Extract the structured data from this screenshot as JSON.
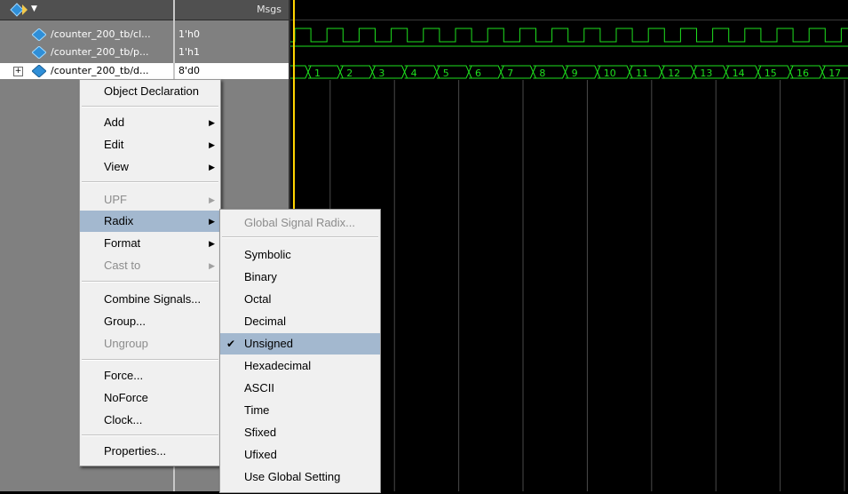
{
  "window": {
    "values_header": "Msgs"
  },
  "signals": [
    {
      "name": "/counter_200_tb/cl...",
      "value": "1'h0"
    },
    {
      "name": "/counter_200_tb/p...",
      "value": "1'h1"
    },
    {
      "name": "/counter_200_tb/d...",
      "value": "8'd0"
    }
  ],
  "bus_values": [
    "1",
    "2",
    "3",
    "4",
    "5",
    "6",
    "7",
    "8",
    "9",
    "10",
    "11",
    "12",
    "13",
    "14",
    "15",
    "16",
    "17"
  ],
  "context_menu": {
    "items": [
      {
        "label": "Object Declaration",
        "enabled": true,
        "submenu": false
      },
      {
        "label": "Add",
        "enabled": true,
        "submenu": true
      },
      {
        "label": "Edit",
        "enabled": true,
        "submenu": true
      },
      {
        "label": "View",
        "enabled": true,
        "submenu": true
      },
      {
        "label": "UPF",
        "enabled": false,
        "submenu": true
      },
      {
        "label": "Radix",
        "enabled": true,
        "submenu": true,
        "highlighted": true
      },
      {
        "label": "Format",
        "enabled": true,
        "submenu": true
      },
      {
        "label": "Cast to",
        "enabled": false,
        "submenu": true
      },
      {
        "label": "Combine Signals...",
        "enabled": true,
        "submenu": false
      },
      {
        "label": "Group...",
        "enabled": true,
        "submenu": false
      },
      {
        "label": "Ungroup",
        "enabled": false,
        "submenu": false
      },
      {
        "label": "Force...",
        "enabled": true,
        "submenu": false
      },
      {
        "label": "NoForce",
        "enabled": true,
        "submenu": false
      },
      {
        "label": "Clock...",
        "enabled": true,
        "submenu": false
      },
      {
        "label": "Properties...",
        "enabled": true,
        "submenu": false
      }
    ]
  },
  "radix_menu": {
    "items": [
      {
        "label": "Global Signal Radix...",
        "enabled": false
      },
      {
        "label": "Symbolic",
        "enabled": true
      },
      {
        "label": "Binary",
        "enabled": true
      },
      {
        "label": "Octal",
        "enabled": true
      },
      {
        "label": "Decimal",
        "enabled": true
      },
      {
        "label": "Unsigned",
        "enabled": true,
        "checked": true
      },
      {
        "label": "Hexadecimal",
        "enabled": true
      },
      {
        "label": "ASCII",
        "enabled": true
      },
      {
        "label": "Time",
        "enabled": true
      },
      {
        "label": "Sfixed",
        "enabled": true
      },
      {
        "label": "Ufixed",
        "enabled": true
      },
      {
        "label": "Use Global Setting",
        "enabled": true
      }
    ]
  },
  "colors": {
    "wave_green": "#1ee01e",
    "cursor": "#ffd400",
    "menu_highlight": "#a3b8cf",
    "signal_icon": "#2f8fd8"
  },
  "icons": {
    "signal": "diamond-icon",
    "submenu": "triangle-right-icon",
    "checked": "check-mark-icon",
    "expand": "plus-box-icon"
  }
}
